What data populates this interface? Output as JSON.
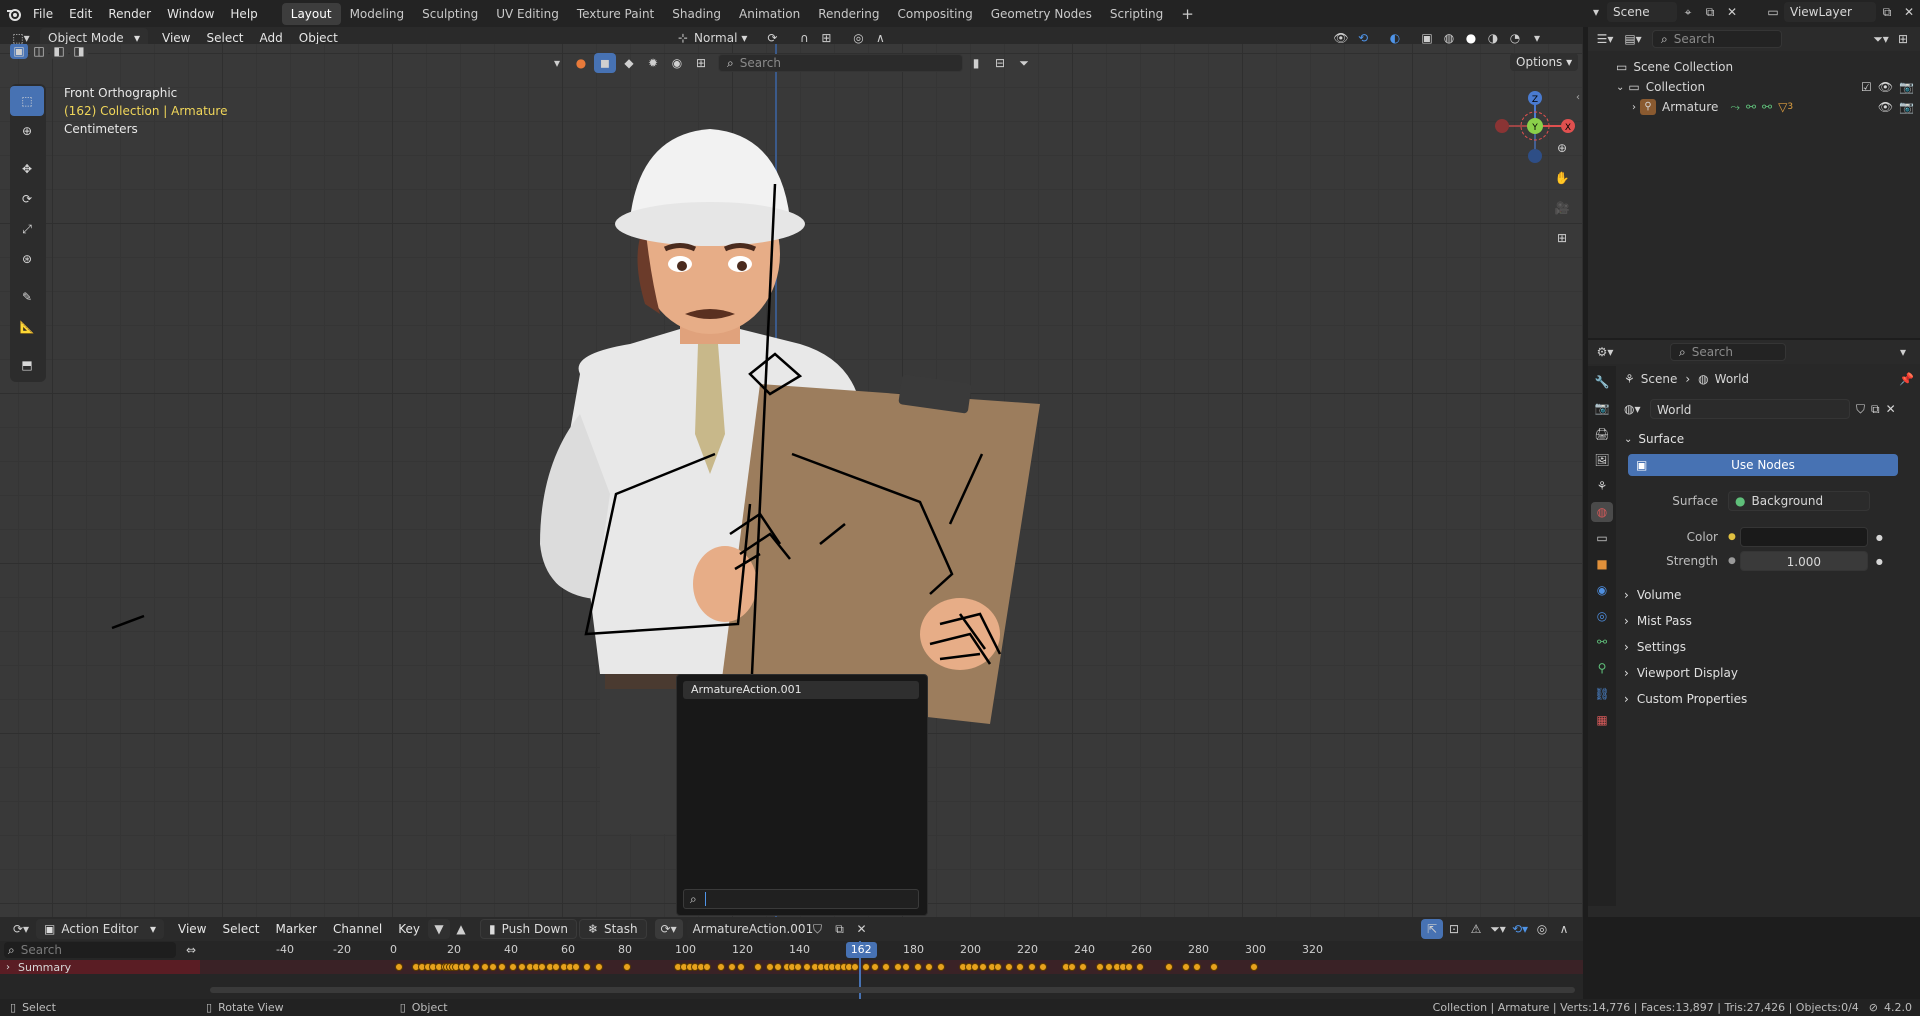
{
  "menu": {
    "items": [
      "File",
      "Edit",
      "Render",
      "Window",
      "Help"
    ]
  },
  "workspaces": [
    "Layout",
    "Modeling",
    "Sculpting",
    "UV Editing",
    "Texture Paint",
    "Shading",
    "Animation",
    "Rendering",
    "Compositing",
    "Geometry Nodes",
    "Scripting"
  ],
  "workspace_active": "Layout",
  "top_right": {
    "scene": "Scene",
    "view_layer": "ViewLayer"
  },
  "viewport_header": {
    "mode": "Object Mode",
    "menus": [
      "View",
      "Select",
      "Add",
      "Object"
    ],
    "transform_orientation": "Normal",
    "search_placeholder": "Search",
    "options": "Options"
  },
  "overlay_text": {
    "view_name": "Front Orthographic",
    "collection_info": "(162) Collection | Armature",
    "units": "Centimeters"
  },
  "gizmo": {
    "z": "Z",
    "y": "Y",
    "x": "X"
  },
  "action_popup": {
    "item": "ArmatureAction.001",
    "search_value": ""
  },
  "outliner": {
    "search_placeholder": "Search",
    "scene_collection": "Scene Collection",
    "collection": "Collection",
    "armature": "Armature",
    "armature_badge": "3"
  },
  "properties": {
    "search_placeholder": "Search",
    "breadcrumb": [
      "Scene",
      "World"
    ],
    "world_name": "World",
    "surface_section": "Surface",
    "use_nodes": "Use Nodes",
    "surface_label": "Surface",
    "surface_value": "Background",
    "color_label": "Color",
    "strength_label": "Strength",
    "strength_value": "1.000",
    "sections": [
      "Volume",
      "Mist Pass",
      "Settings",
      "Viewport Display",
      "Custom Properties"
    ]
  },
  "action_editor": {
    "editor": "Action Editor",
    "menus": [
      "View",
      "Select",
      "Marker",
      "Channel",
      "Key"
    ],
    "push_down": "Push Down",
    "stash": "Stash",
    "action_name": "ArmatureAction.001",
    "search_placeholder": "Search",
    "summary": "Summary",
    "current_frame": "162",
    "ticks": [
      "-40",
      "-20",
      "0",
      "20",
      "40",
      "60",
      "80",
      "100",
      "120",
      "140",
      "162",
      "180",
      "200",
      "220",
      "240",
      "260",
      "280",
      "300",
      "320"
    ],
    "keyframes": [
      0,
      6,
      8,
      10,
      12,
      14,
      16,
      17,
      18,
      19,
      20,
      22,
      24,
      27,
      30,
      33,
      36,
      40,
      43,
      46,
      48,
      50,
      53,
      55,
      58,
      60,
      62,
      66,
      70,
      80,
      98,
      100,
      102,
      104,
      106,
      108,
      113,
      117,
      120,
      126,
      130,
      133,
      136,
      138,
      140,
      143,
      146,
      148,
      150,
      152,
      154,
      156,
      158,
      160,
      164,
      167,
      171,
      175,
      178,
      182,
      186,
      190,
      198,
      200,
      202,
      205,
      208,
      210,
      214,
      218,
      222,
      226,
      234,
      236,
      240,
      246,
      249,
      252,
      254,
      256,
      260,
      270,
      276,
      280,
      286,
      300
    ]
  },
  "statusbar": {
    "select": "Select",
    "rotate_view": "Rotate View",
    "object": "Object",
    "stats": "Collection | Armature | Verts:14,776 | Faces:13,897 | Tris:27,426 | Objects:0/4",
    "version": "4.2.0"
  },
  "colors": {
    "accent": "#4772b3",
    "keyframe": "#e7a21d",
    "playhead": "#4772b3",
    "summary_row": "#5a1d24"
  }
}
